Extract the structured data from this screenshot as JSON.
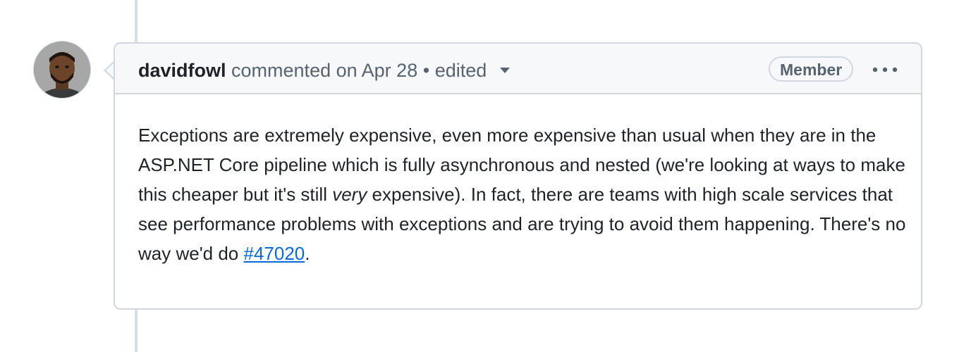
{
  "comment": {
    "author": "davidfowl",
    "action": "commented on",
    "date": "Apr 28",
    "separator": "•",
    "edited_label": "edited",
    "badge": "Member",
    "body": {
      "part1": "Exceptions are extremely expensive, even more expensive than usual when they are in the ASP.NET Core pipeline which is fully asynchronous and nested (we're looking at ways to make this cheaper but it's still ",
      "emphasis": "very",
      "part2": " expensive). In fact, there are teams with high scale services that see performance problems with exceptions and are trying to avoid them happening. There's no way we'd do ",
      "link_text": "#47020",
      "part3": "."
    }
  },
  "icons": {
    "avatar": "avatar-photo",
    "edited_dropdown": "chevron-down-icon",
    "options": "kebab-horizontal-icon"
  },
  "colors": {
    "link": "#0969da",
    "border": "#d0d7de",
    "header_bg": "#f6f8fa",
    "muted_text": "#59636e"
  }
}
